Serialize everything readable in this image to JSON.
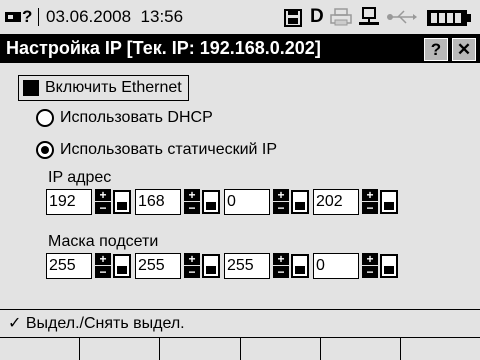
{
  "status": {
    "user_icon": "device-icon",
    "question": "?",
    "datetime": "03.06.2008  13:56",
    "icons": [
      "save-icon",
      "d-icon",
      "printer-icon",
      "network-icon",
      "usb-icon",
      "battery-icon"
    ],
    "d_letter": "D"
  },
  "title": {
    "text": "Настройка IP [Тек. IP: 192.168.0.202]",
    "help": "?",
    "close": "✕"
  },
  "ethernet": {
    "label": "Включить Ethernet",
    "checked": true
  },
  "radios": {
    "dhcp_label": "Использовать DHCP",
    "static_label": "Использовать статический IP",
    "selected": "static"
  },
  "ip": {
    "label": "IP адрес",
    "octets": [
      "192",
      "168",
      "0",
      "202"
    ]
  },
  "mask": {
    "label": "Маска подсети",
    "octets": [
      "255",
      "255",
      "255",
      "0"
    ]
  },
  "hint": {
    "check": "✓",
    "text": "Выдел./Снять выдел."
  },
  "softkeys": [
    "",
    "",
    "",
    "",
    "",
    ""
  ]
}
